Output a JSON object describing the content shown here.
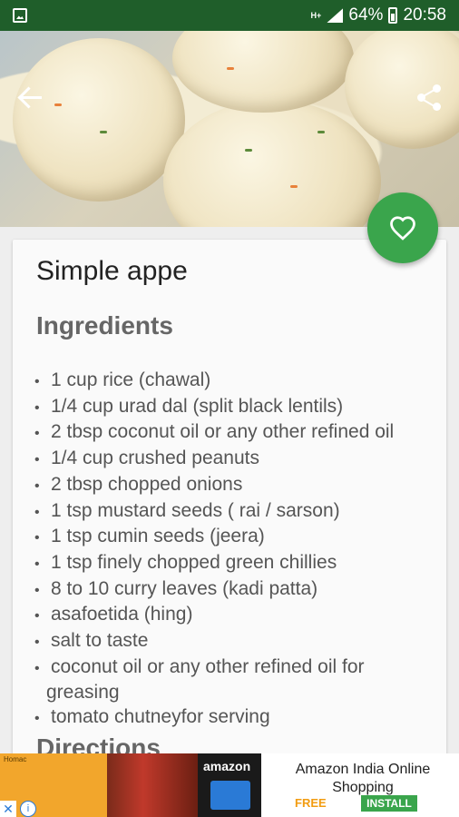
{
  "status_bar": {
    "battery": "64%",
    "time": "20:58",
    "network": "H+",
    "icons": [
      "gallery-icon",
      "signal-icon",
      "battery-icon"
    ]
  },
  "header": {
    "back_icon": "back-arrow-icon",
    "share_icon": "share-icon",
    "favorite_icon": "heart-outline-icon"
  },
  "recipe": {
    "title": "Simple appe",
    "ingredients_heading": "Ingredients",
    "ingredients": [
      "1 cup rice (chawal)",
      "1/4 cup urad dal (split black lentils)",
      "2 tbsp coconut oil or any other refined oil",
      "1/4 cup crushed peanuts",
      "2 tbsp chopped onions",
      "1 tsp mustard seeds ( rai / sarson)",
      "1 tsp cumin seeds (jeera)",
      "1 tsp finely chopped green chillies",
      "8 to 10 curry leaves (kadi patta)",
      "asafoetida (hing)",
      "salt to taste",
      "coconut oil or any other refined oil for greasing",
      "tomato chutneyfor serving"
    ],
    "directions_heading": "Directions"
  },
  "ad": {
    "title": "Amazon India Online Shopping",
    "logo_text": "amazon",
    "free_label": "FREE",
    "install_label": "INSTALL",
    "close_symbol": "✕",
    "info_symbol": "i",
    "thumb_text": "Homac"
  },
  "colors": {
    "status_bar": "#1f5e2a",
    "fab": "#3aa54c",
    "install": "#3aa54c",
    "free": "#f29c11"
  }
}
